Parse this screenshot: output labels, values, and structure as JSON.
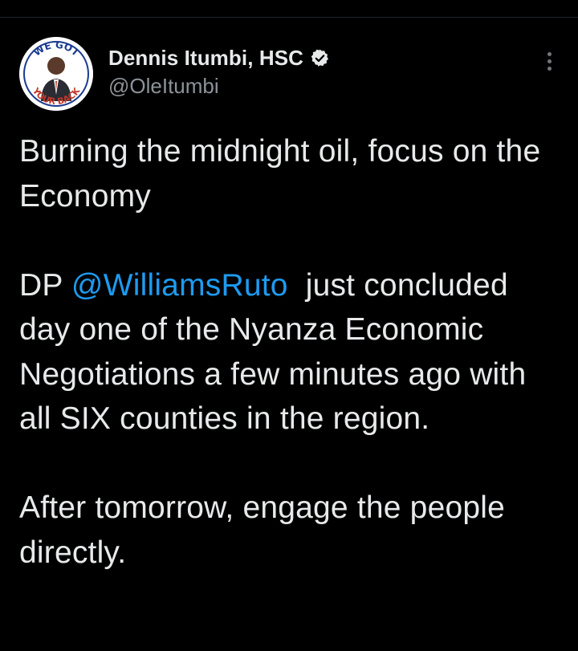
{
  "tweet": {
    "author": {
      "display_name": "Dennis Itumbi, HSC",
      "handle": "@OleItumbi",
      "verified": true,
      "avatar_text_top": "WE GOT",
      "avatar_text_bottom": "YOUR BACK"
    },
    "more_icon": "more-vertical-icon",
    "paragraphs": {
      "p1": "Burning the midnight oil, focus on the Economy",
      "p2_prefix": "DP ",
      "p2_mention": "@WilliamsRuto",
      "p2_suffix": "  just concluded day one of the Nyanza Economic Negotiations a few minutes ago with all SIX counties in the region.",
      "p3": "After tomorrow, engage the people directly."
    }
  },
  "colors": {
    "background": "#000000",
    "text": "#e7e9ea",
    "secondary_text": "#8b9399",
    "mention": "#1d9bf0",
    "verified_badge": "#e7e9ea"
  }
}
